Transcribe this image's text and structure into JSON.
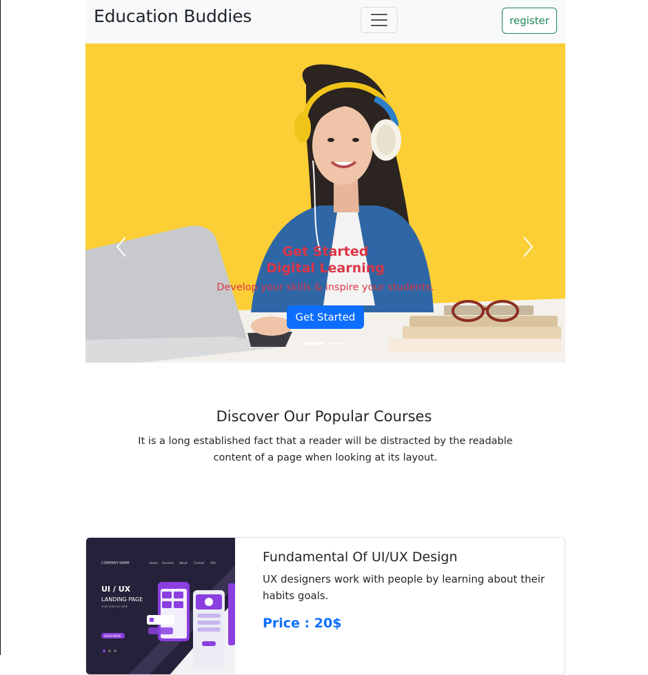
{
  "navbar": {
    "brand": "Education Buddies",
    "register_label": "register"
  },
  "carousel": {
    "caption_title": "Get Started Digital Learning",
    "caption_subtitle": "Develop your skills & inspire your students.",
    "cta_label": "Get Started",
    "slide_count": 2,
    "active_slide": 1,
    "background_color": "#fbcf35"
  },
  "courses_section": {
    "title": "Discover Our Popular Courses",
    "description": "It is a long established fact that a reader will be distracted by the readable content of a page when looking at its layout."
  },
  "courses": [
    {
      "title": "Fundamental Of UI/UX Design",
      "description": "UX designers work with people by learning about their habits goals.",
      "price": "Price : 20$",
      "thumbnail": {
        "company": "COMPANY NAME",
        "nav": [
          "Home",
          "Services",
          "About",
          "Contact",
          "FAQ"
        ],
        "heading": "UI / UX",
        "subheading": "LANDING PAGE",
        "tagline": "YOUR SUBTITLE HERE",
        "button": "READ MORE"
      }
    }
  ],
  "colors": {
    "primary": "#0d6efd",
    "success": "#198754",
    "danger": "#dc3545"
  }
}
